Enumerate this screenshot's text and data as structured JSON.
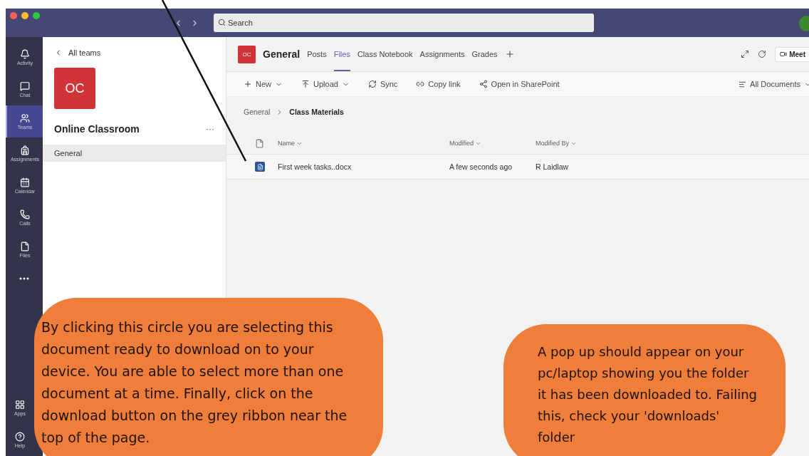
{
  "title_bar": {
    "search": {
      "placeholder": "Search"
    }
  },
  "app_bar": {
    "items": [
      {
        "label": "Activity",
        "selected": false
      },
      {
        "label": "Chat",
        "selected": false
      },
      {
        "label": "Teams",
        "selected": true
      },
      {
        "label": "Assignments",
        "selected": false
      },
      {
        "label": "Calendar",
        "selected": false
      },
      {
        "label": "Calls",
        "selected": false
      },
      {
        "label": "Files",
        "selected": false
      }
    ],
    "bottom_items": [
      {
        "label": "Apps"
      },
      {
        "label": "Help"
      }
    ]
  },
  "team_panel": {
    "back": "All teams",
    "avatar": "OC",
    "name": "Online Classroom",
    "more": "···",
    "channels": [
      {
        "label": "General",
        "selected": true
      }
    ]
  },
  "channel": {
    "avatar": "OC",
    "name": "General",
    "tabs": [
      {
        "label": "Posts",
        "selected": false
      },
      {
        "label": "Files",
        "selected": true
      },
      {
        "label": "Class Notebook",
        "selected": false
      },
      {
        "label": "Assignments",
        "selected": false
      },
      {
        "label": "Grades",
        "selected": false
      }
    ],
    "meet": "Meet"
  },
  "toolbar": {
    "actions": [
      {
        "label": "New",
        "dropdown": true
      },
      {
        "label": "Upload",
        "dropdown": true
      },
      {
        "label": "Sync",
        "dropdown": false
      },
      {
        "label": "Copy link",
        "dropdown": false
      },
      {
        "label": "Open in SharePoint",
        "dropdown": false
      }
    ],
    "view": "All Documents"
  },
  "breadcrumb": [
    "General",
    "Class Materials"
  ],
  "table": {
    "columns": [
      "Name",
      "Modified",
      "Modified By"
    ],
    "rows": [
      {
        "name": "First week tasks..docx",
        "modified": "A few seconds ago",
        "modified_by": "R Laidlaw"
      }
    ]
  },
  "callouts": [
    {
      "text": "By clicking this circle you are selecting this document ready to download on to your device. You are able to select more than one document at a time. Finally, click on the download button on the grey ribbon near the top of the page."
    },
    {
      "text": "A pop up should appear on your pc/laptop showing you the folder it has been downloaded to. Failing this, check your 'downloads' folder"
    }
  ]
}
